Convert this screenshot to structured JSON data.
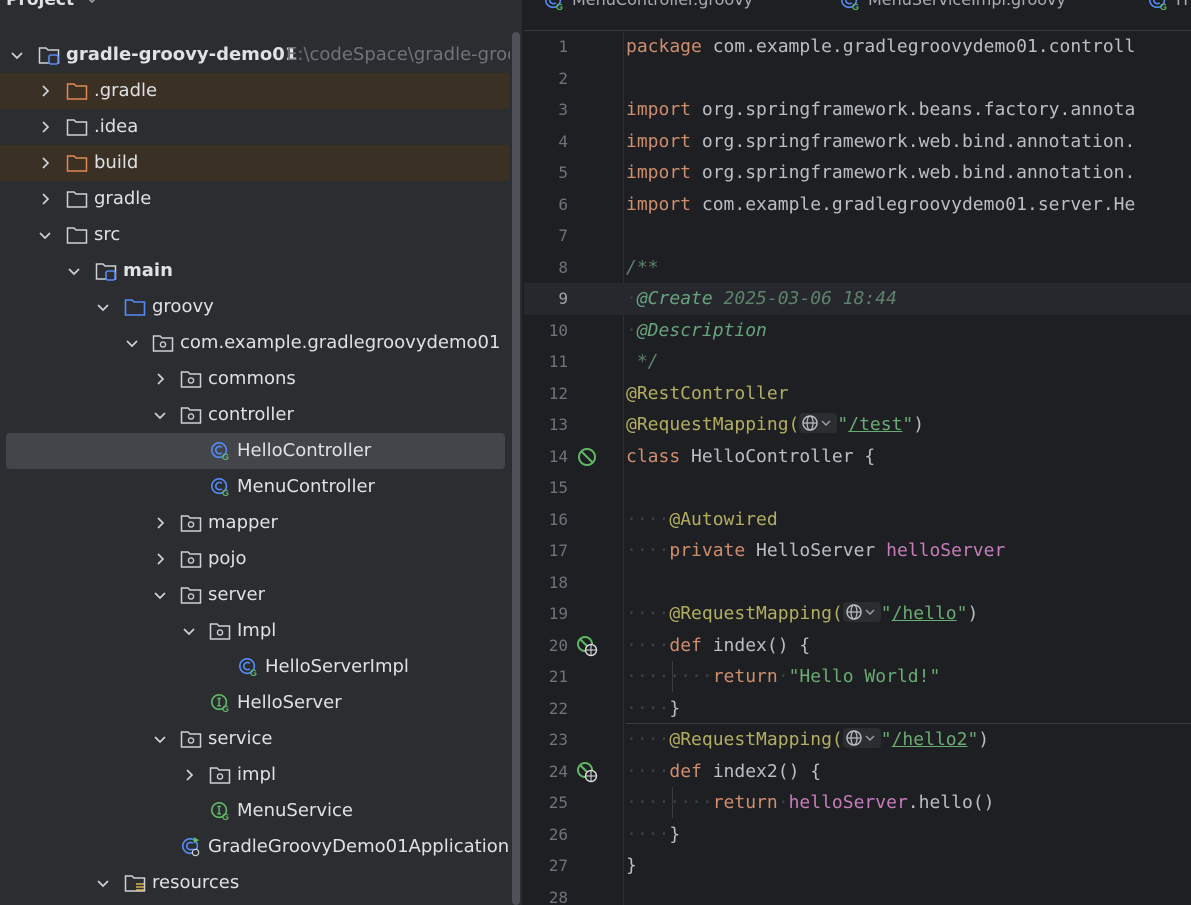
{
  "project_panel": {
    "title": "Project",
    "tree": [
      {
        "label": "gradle-groovy-demo01",
        "secondary": "E:\\codeSpace\\gradle-groovy",
        "icon": "module-folder-icon",
        "expanded": true
      },
      {
        "label": ".gradle",
        "icon": "folder-excluded-icon",
        "expanded": false
      },
      {
        "label": ".idea",
        "icon": "folder-icon",
        "expanded": false
      },
      {
        "label": "build",
        "icon": "folder-excluded-icon",
        "expanded": false
      },
      {
        "label": "gradle",
        "icon": "folder-icon",
        "expanded": false
      },
      {
        "label": "src",
        "icon": "folder-icon",
        "expanded": true
      },
      {
        "label": "main",
        "icon": "module-folder-icon",
        "expanded": true
      },
      {
        "label": "groovy",
        "icon": "source-root-icon",
        "expanded": true
      },
      {
        "label": "com.example.gradlegroovydemo01",
        "icon": "package-icon",
        "expanded": true
      },
      {
        "label": "commons",
        "icon": "package-icon",
        "expanded": false
      },
      {
        "label": "controller",
        "icon": "package-icon",
        "expanded": true
      },
      {
        "label": "HelloController",
        "icon": "groovy-class-icon"
      },
      {
        "label": "MenuController",
        "icon": "groovy-class-icon"
      },
      {
        "label": "mapper",
        "icon": "package-icon",
        "expanded": false
      },
      {
        "label": "pojo",
        "icon": "package-icon",
        "expanded": false
      },
      {
        "label": "server",
        "icon": "package-icon",
        "expanded": true
      },
      {
        "label": "Impl",
        "icon": "package-icon",
        "expanded": true
      },
      {
        "label": "HelloServerImpl",
        "icon": "groovy-class-icon"
      },
      {
        "label": "HelloServer",
        "icon": "groovy-interface-icon"
      },
      {
        "label": "service",
        "icon": "package-icon",
        "expanded": true
      },
      {
        "label": "impl",
        "icon": "package-icon",
        "expanded": false
      },
      {
        "label": "MenuService",
        "icon": "groovy-interface-icon"
      },
      {
        "label": "GradleGroovyDemo01Application",
        "icon": "groovy-app-class-icon"
      },
      {
        "label": "resources",
        "icon": "resources-folder-icon",
        "expanded": true
      }
    ],
    "selected": "HelloController"
  },
  "editor_tabs": [
    {
      "label": "MenuController.groovy",
      "icon": "groovy-class-icon"
    },
    {
      "label": "MenuServiceImpl.groovy",
      "icon": "groovy-class-icon"
    },
    {
      "label": "H",
      "icon": "groovy-class-icon"
    }
  ],
  "editor": {
    "current_line": 9,
    "line_numbers": [
      "1",
      "2",
      "3",
      "4",
      "5",
      "6",
      "7",
      "8",
      "9",
      "10",
      "11",
      "12",
      "13",
      "14",
      "15",
      "16",
      "17",
      "18",
      "19",
      "20",
      "21",
      "22",
      "23",
      "24",
      "25",
      "26",
      "27",
      "28"
    ],
    "tokens": {
      "l1_kw": "package",
      "l1_rest": " com.example.gradlegroovydemo01.controll",
      "l3_kw": "import",
      "l3_rest": " org.springframework.beans.factory.annota",
      "l4_kw": "import",
      "l4_rest": " org.springframework.web.bind.annotation.",
      "l5_kw": "import",
      "l5_rest": " org.springframework.web.bind.annotation.",
      "l6_kw": "import",
      "l6_rest": " com.example.gradlegroovydemo01.server.He",
      "l8": "/**",
      "l9_tag": "@Create",
      "l9_rest": " 2025-03-06 18:44",
      "l10_tag": "@Description",
      "l11": " */",
      "l12": "@RestController",
      "l13_ann": "@RequestMapping(",
      "l13_q1": "\"",
      "l13_path": "/test",
      "l13_q2": "\"",
      "l13_close": ")",
      "l14_kw": "class",
      "l14_rest": " HelloController {",
      "l16": "@Autowired",
      "l17_kw": "private",
      "l17_type": " HelloServer ",
      "l17_field": "helloServer",
      "l19_ann": "@RequestMapping(",
      "l19_q1": "\"",
      "l19_path": "/hello",
      "l19_q2": "\"",
      "l19_close": ")",
      "l20_kw": "def",
      "l20_rest": " index() {",
      "l21_kw": "return",
      "l21_str": "\"Hello World!\"",
      "l22": "}",
      "l23_ann": "@RequestMapping(",
      "l23_q1": "\"",
      "l23_path": "/hello2",
      "l23_q2": "\"",
      "l23_close": ")",
      "l24_kw": "def",
      "l24_rest": " index2() {",
      "l25_kw": "return",
      "l25_field": "helloServer",
      "l25_rest": ".hello()",
      "l26": "}",
      "l27": "}"
    }
  },
  "colors": {
    "keyword": "#cf8e6d",
    "annotation": "#b3ae60",
    "comment": "#5f826b",
    "string": "#6aab73",
    "field": "#c77dbb",
    "background": "#1e1f22",
    "panel": "#2b2d30"
  }
}
